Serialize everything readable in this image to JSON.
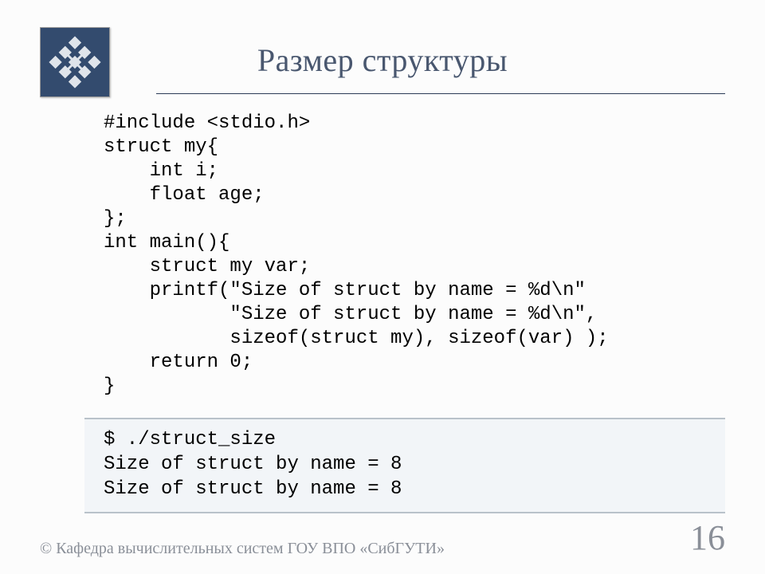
{
  "header": {
    "title": "Размер структуры"
  },
  "code": {
    "lines": [
      "#include <stdio.h>",
      "struct my{",
      "    int i;",
      "    float age;",
      "};",
      "int main(){",
      "    struct my var;",
      "    printf(\"Size of struct by name = %d\\n\"",
      "           \"Size of struct by name = %d\\n\",",
      "           sizeof(struct my), sizeof(var) );",
      "    return 0;",
      "}"
    ]
  },
  "output": {
    "lines": [
      "$ ./struct_size",
      "Size of struct by name = 8",
      "Size of struct by name = 8"
    ]
  },
  "footer": {
    "copyright": "© Кафедра вычислительных систем ГОУ ВПО «СибГУТИ»",
    "page_number": "16"
  }
}
